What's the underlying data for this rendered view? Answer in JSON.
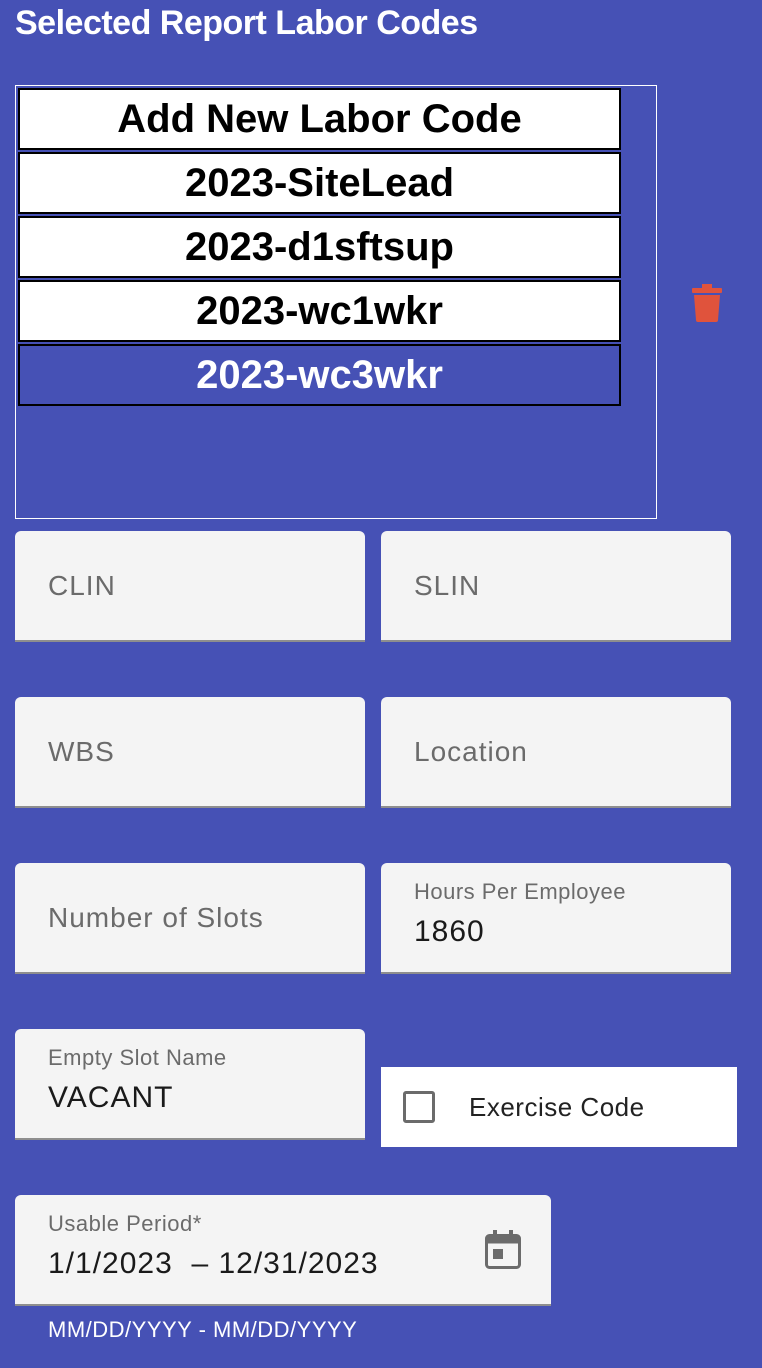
{
  "title": "Selected Report Labor Codes",
  "labor_codes": [
    {
      "label": "Add New Labor Code",
      "selected": false
    },
    {
      "label": "2023-SiteLead",
      "selected": false
    },
    {
      "label": "2023-d1sftsup",
      "selected": false
    },
    {
      "label": "2023-wc1wkr",
      "selected": false
    },
    {
      "label": "2023-wc3wkr",
      "selected": true
    }
  ],
  "icons": {
    "delete": "trash-icon",
    "calendar": "calendar-icon"
  },
  "fields": {
    "clin": {
      "placeholder": "CLIN"
    },
    "slin": {
      "placeholder": "SLIN"
    },
    "wbs": {
      "placeholder": "WBS"
    },
    "location": {
      "placeholder": "Location"
    },
    "number_of_slots": {
      "placeholder": "Number of Slots"
    },
    "hours_per_employee": {
      "label": "Hours Per Employee",
      "value": "1860"
    },
    "empty_slot_name": {
      "label": "Empty Slot Name",
      "value": "VACANT"
    },
    "usable_period": {
      "label": "Usable Period*",
      "value": "1/1/2023  – 12/31/2023",
      "hint": "MM/DD/YYYY - MM/DD/YYYY"
    }
  },
  "exercise_code": {
    "label": "Exercise Code",
    "checked": false
  },
  "colors": {
    "background": "#4651b5",
    "delete_icon": "#e0533c",
    "field_bg": "#f4f4f4"
  }
}
